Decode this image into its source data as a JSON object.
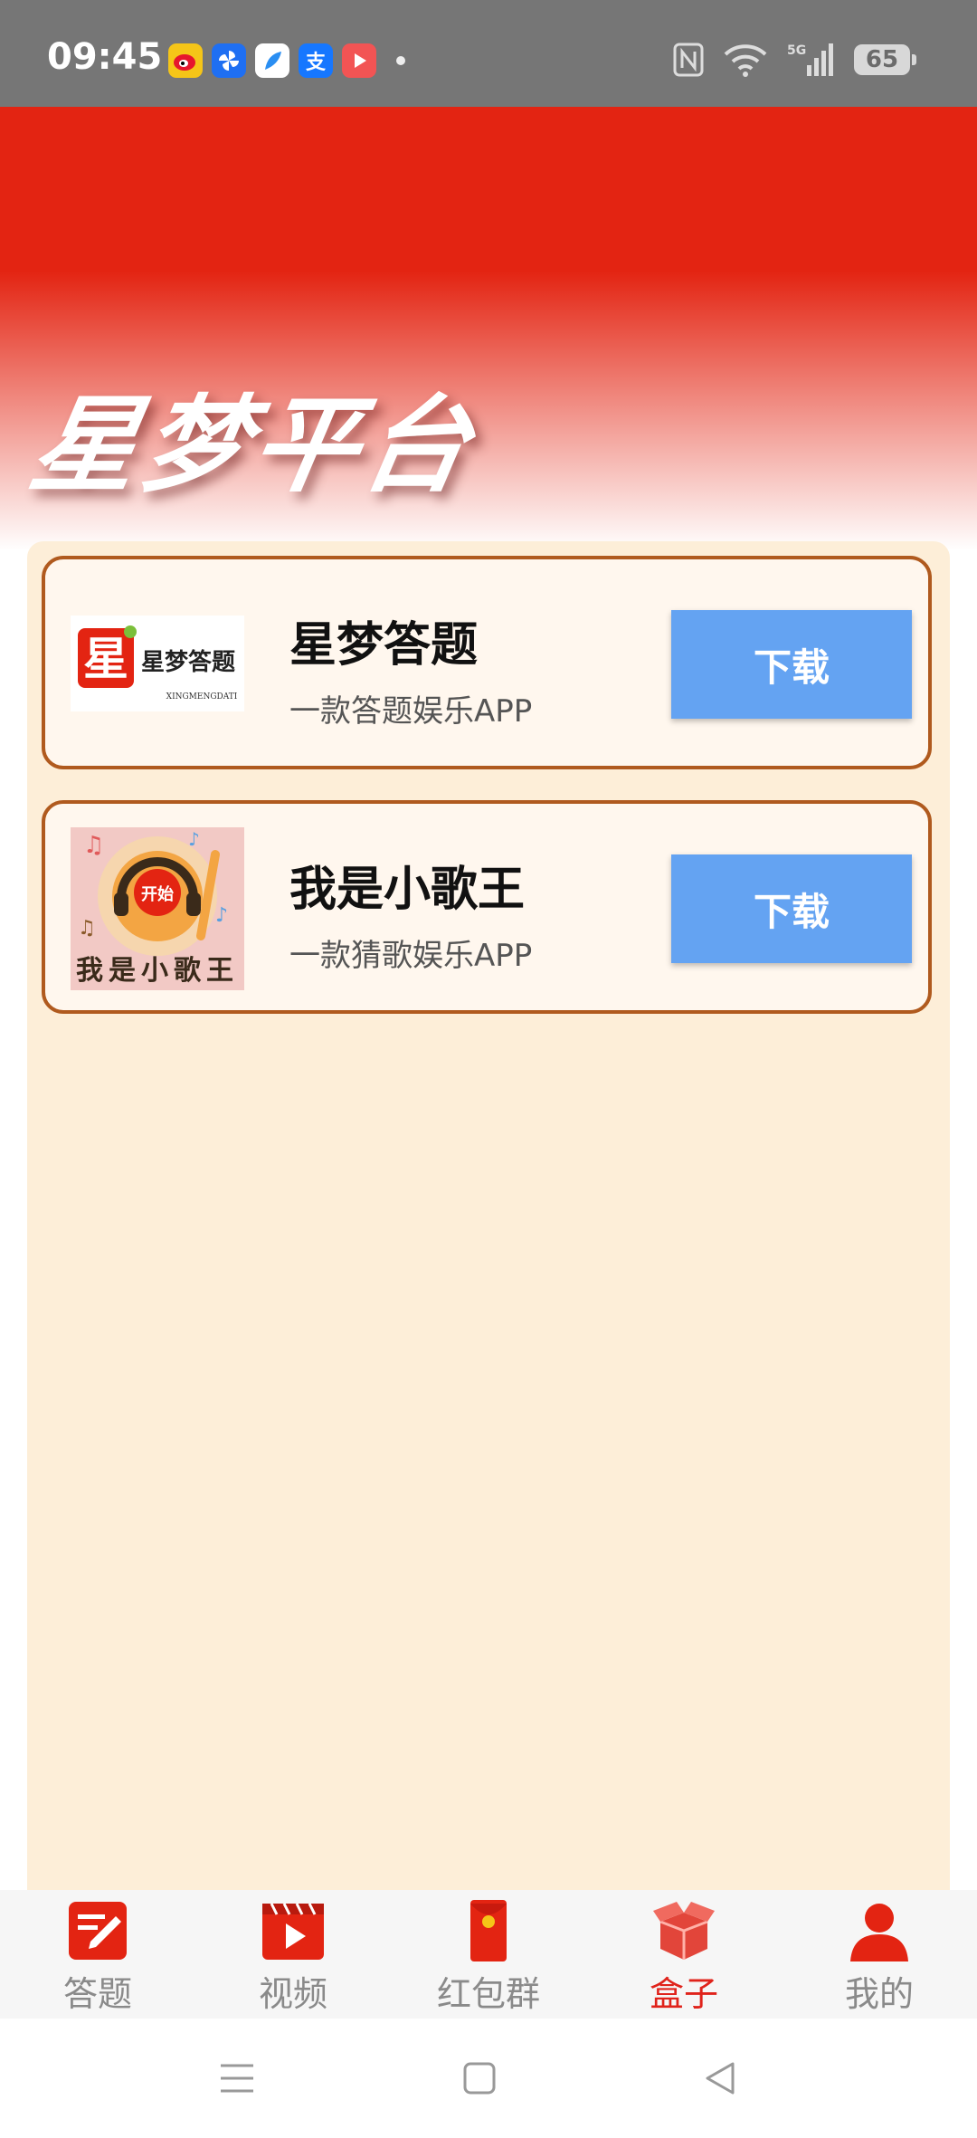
{
  "status_bar": {
    "time": "09:45",
    "notification_icons": [
      "weibo-icon",
      "pinwheel-icon",
      "feather-app-icon",
      "alipay-icon",
      "video-app-icon"
    ],
    "alipay_glyph": "支",
    "battery": "65",
    "network": "5G"
  },
  "header": {
    "brand": "星梦平台",
    "color": "#e32412"
  },
  "apps": [
    {
      "thumb_title": "星梦答题",
      "thumb_logo_char": "星",
      "thumb_sub": "XINGMENGDATI",
      "title": "星梦答题",
      "desc": "一款答题娱乐APP",
      "button": "下载"
    },
    {
      "thumb_badge": "开始",
      "thumb_caption": "我是小歌王",
      "title": "我是小歌王",
      "desc": "一款猜歌娱乐APP",
      "button": "下载"
    }
  ],
  "tabs": [
    {
      "label": "答题",
      "icon": "pencil-note-icon"
    },
    {
      "label": "视频",
      "icon": "video-play-icon"
    },
    {
      "label": "红包群",
      "icon": "red-envelope-icon"
    },
    {
      "label": "盒子",
      "icon": "gift-box-icon",
      "active": true
    },
    {
      "label": "我的",
      "icon": "user-icon"
    }
  ],
  "colors": {
    "accent": "#e0231b",
    "button": "#64a3f2",
    "panel": "#fdeed8",
    "card_border": "#b05a1e"
  }
}
